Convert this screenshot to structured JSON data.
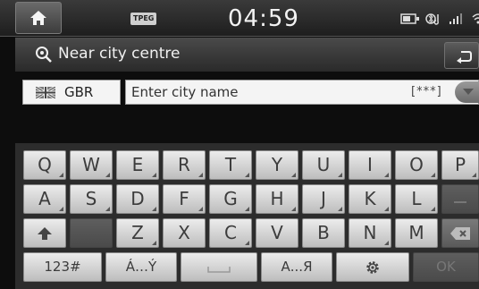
{
  "status": {
    "tpeg_label": "TPEG",
    "time": "04:59"
  },
  "header": {
    "title": "Near city centre"
  },
  "country": {
    "code": "GBR"
  },
  "city_input": {
    "placeholder": "Enter city name",
    "hint": "[***]"
  },
  "keyboard": {
    "row1": [
      "Q",
      "W",
      "E",
      "R",
      "T",
      "Y",
      "U",
      "I",
      "O",
      "P"
    ],
    "row2": [
      "A",
      "S",
      "D",
      "F",
      "G",
      "H",
      "J",
      "K",
      "L"
    ],
    "row3": [
      "Z",
      "X",
      "C",
      "V",
      "B",
      "N",
      "M"
    ],
    "mode_123": "123#",
    "mode_accent": "Á…Ý",
    "mode_cyrillic": "А...Я",
    "ok": "OK"
  },
  "colors": {
    "key_light": "#e6e6e6",
    "key_text": "#3c3c3c",
    "bar_dark": "#2a2a2a"
  }
}
